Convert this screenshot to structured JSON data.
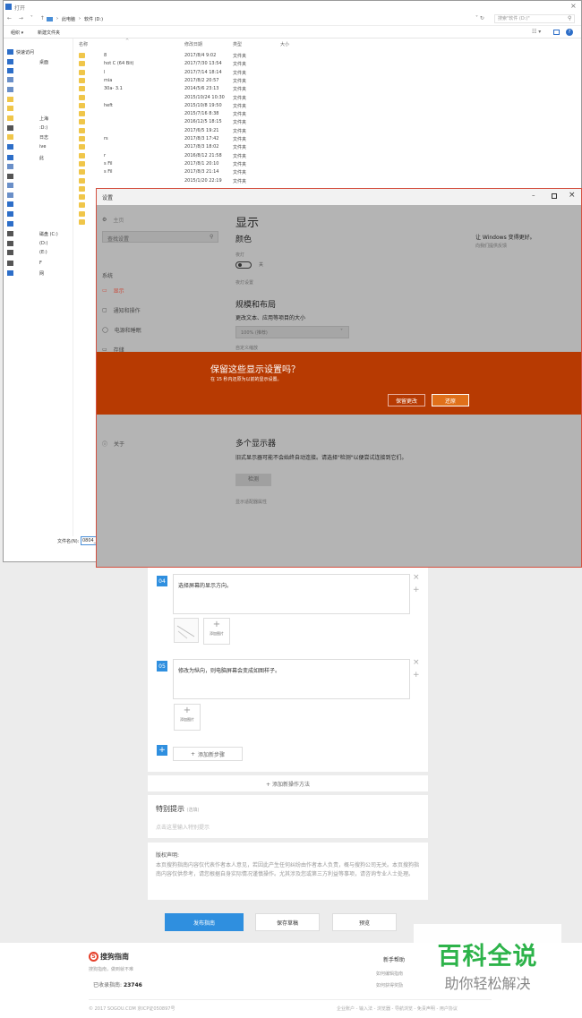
{
  "explorer": {
    "title": "打开",
    "breadcrumb": [
      "此电脑",
      "软件 (D:)"
    ],
    "search_placeholder": "搜索\"软件 (D:)\"",
    "toolbar": {
      "organize": "组织 ▾",
      "new_folder": "新建文件夹"
    },
    "columns": {
      "name": "名称",
      "date": "修改日期",
      "type": "类型",
      "size": "大小"
    },
    "nav": [
      {
        "label": "快速访问",
        "icon": "star-icon"
      },
      {
        "label": "桌面",
        "icon": "desktop-icon"
      },
      {
        "label": "",
        "icon": "download-icon"
      },
      {
        "label": "",
        "icon": "document-icon"
      },
      {
        "label": "",
        "icon": "picture-icon"
      },
      {
        "label": "",
        "icon": "folder-icon"
      },
      {
        "label": "",
        "icon": "folder-icon"
      },
      {
        "label": "上海",
        "icon": "folder-icon"
      },
      {
        "label": ":D:)",
        "icon": "drive-icon"
      },
      {
        "label": "日志",
        "icon": "folder-icon"
      },
      {
        "label": "ive",
        "icon": "cloud-icon"
      },
      {
        "label": "此",
        "icon": "pc-icon"
      },
      {
        "label": "",
        "icon": "3d-icon"
      },
      {
        "label": "",
        "icon": "video-icon"
      },
      {
        "label": "",
        "icon": "picture-icon"
      },
      {
        "label": "",
        "icon": "document-icon"
      },
      {
        "label": "",
        "icon": "download-icon"
      },
      {
        "label": "",
        "icon": "music-icon"
      },
      {
        "label": "",
        "icon": "desktop-icon"
      },
      {
        "label": "磁盘 (C:)",
        "icon": "drive-icon"
      },
      {
        "label": "(D:)",
        "icon": "drive-icon"
      },
      {
        "label": "(E:)",
        "icon": "drive-icon"
      },
      {
        "label": "F",
        "icon": "usb-icon"
      },
      {
        "label": "网",
        "icon": "network-icon"
      }
    ],
    "files": [
      {
        "name": "8",
        "date": "2017/8/4 9:02",
        "type": "文件夹"
      },
      {
        "name": "hot C (64 Bit)",
        "date": "2017/7/30 13:54",
        "type": "文件夹"
      },
      {
        "name": "l",
        "date": "2017/7/14 18:14",
        "type": "文件夹"
      },
      {
        "name": "mia",
        "date": "2017/8/2 20:57",
        "type": "文件夹"
      },
      {
        "name": "30a- 3.1",
        "date": "2014/5/6 23:13",
        "type": "文件夹"
      },
      {
        "name": "",
        "date": "2015/10/24 10:30",
        "type": "文件夹"
      },
      {
        "name": "heft",
        "date": "2015/10/8 19:50",
        "type": "文件夹"
      },
      {
        "name": "",
        "date": "2015/7/16 8:38",
        "type": "文件夹"
      },
      {
        "name": "",
        "date": "2016/12/5 18:15",
        "type": "文件夹"
      },
      {
        "name": "",
        "date": "2017/6/5 19:21",
        "type": "文件夹"
      },
      {
        "name": "rs",
        "date": "2017/8/3 17:42",
        "type": "文件夹"
      },
      {
        "name": "",
        "date": "2017/8/3 18:02",
        "type": "文件夹"
      },
      {
        "name": "r",
        "date": "2016/8/12 21:58",
        "type": "文件夹"
      },
      {
        "name": "s Fil",
        "date": "2017/8/1 20:10",
        "type": "文件夹"
      },
      {
        "name": "s Fil",
        "date": "2017/8/3 21:14",
        "type": "文件夹"
      },
      {
        "name": "",
        "date": "2015/1/20 22:19",
        "type": "文件夹"
      },
      {
        "name": "",
        "date": "",
        "type": ""
      },
      {
        "name": "",
        "date": "",
        "type": ""
      },
      {
        "name": "",
        "date": "",
        "type": ""
      },
      {
        "name": "",
        "date": "",
        "type": ""
      },
      {
        "name": "",
        "date": "",
        "type": ""
      }
    ],
    "filename_label": "文件名(N):",
    "filename_value": "0804_"
  },
  "settings": {
    "window_title": "设置",
    "home": "主页",
    "search_placeholder": "查找设置",
    "system_label": "系统",
    "nav": [
      {
        "label": "显示",
        "icon": "monitor-icon"
      },
      {
        "label": "通知和操作",
        "icon": "message-icon"
      },
      {
        "label": "电源和睡眠",
        "icon": "power-icon"
      },
      {
        "label": "存储",
        "icon": "storage-icon"
      }
    ],
    "about": "关于",
    "page_title": "显示",
    "color_heading": "颜色",
    "night_light_label": "夜灯",
    "toggle_state": "关",
    "night_light_settings": "夜灯设置",
    "scale_heading": "规模和布局",
    "scale_desc": "更改文本、应用等项目的大小",
    "scale_value": "100% (推荐)",
    "custom_scale": "自定义缩放",
    "multi_heading": "多个显示器",
    "multi_desc": "旧式显示器可能不会始终自动连接。请选择\"检测\"以便尝试连接到它们。",
    "detect_button": "检测",
    "adapter_link": "显示适配器属性",
    "promo_title": "让 Windows 变得更好。",
    "promo_link": "向我们提供反馈",
    "banner": {
      "title": "保留这些显示设置吗？",
      "subtitle": "在 15 秒内还原为以前的显示设置。",
      "keep_button": "保留更改",
      "revert_button": "还原"
    }
  },
  "guide": {
    "steps": [
      {
        "num": "04",
        "text": "选择屏幕的显示方向。"
      },
      {
        "num": "05",
        "text": "修改为纵向，则电脑屏幕会变成如图样子。"
      }
    ],
    "add_image_label": "添加图片",
    "add_step": "添加新步骤",
    "add_method": "+ 添加新操作方法",
    "tip_title": "特别提示",
    "tip_optional": "(选填)",
    "tip_placeholder": "点击这里输入特别提示",
    "copyright_title": "版权声明:",
    "copyright_text": "本页搜狗指南内容仅代表作者本人意见，若因此产生任何纠纷由作者本人负责，概与搜狗公司无关。本页搜狗指南内容仅供参考，请您根据自身实际情况谨慎操作。尤其涉及您或第三方利益等事项，请咨询专业人士处理。",
    "buttons": {
      "publish": "发布指南",
      "save": "保存草稿",
      "preview": "预览"
    }
  },
  "footer": {
    "brand": "搜狗指南",
    "slogan": "搜狗指南，做到就不难",
    "count_label": "已收录指南:",
    "count": "23746",
    "help_title": "新手帮助",
    "help_links": [
      "如何编辑指南",
      "如何获得奖励"
    ],
    "copyright": "© 2017 SOGOU.COM 京ICP证050897号",
    "bottom_links": "企业账户 - 输入法 - 浏览器 - 导航浏览 - 免责声明 - 用户协议"
  },
  "watermark": {
    "main": "百科全说",
    "sub": "助你轻松解决"
  },
  "colors": {
    "accent_blue": "#2f8fdf",
    "banner_orange": "#b73a02",
    "watermark_green": "#2db34a",
    "settings_gray": "#b4b4b4"
  }
}
